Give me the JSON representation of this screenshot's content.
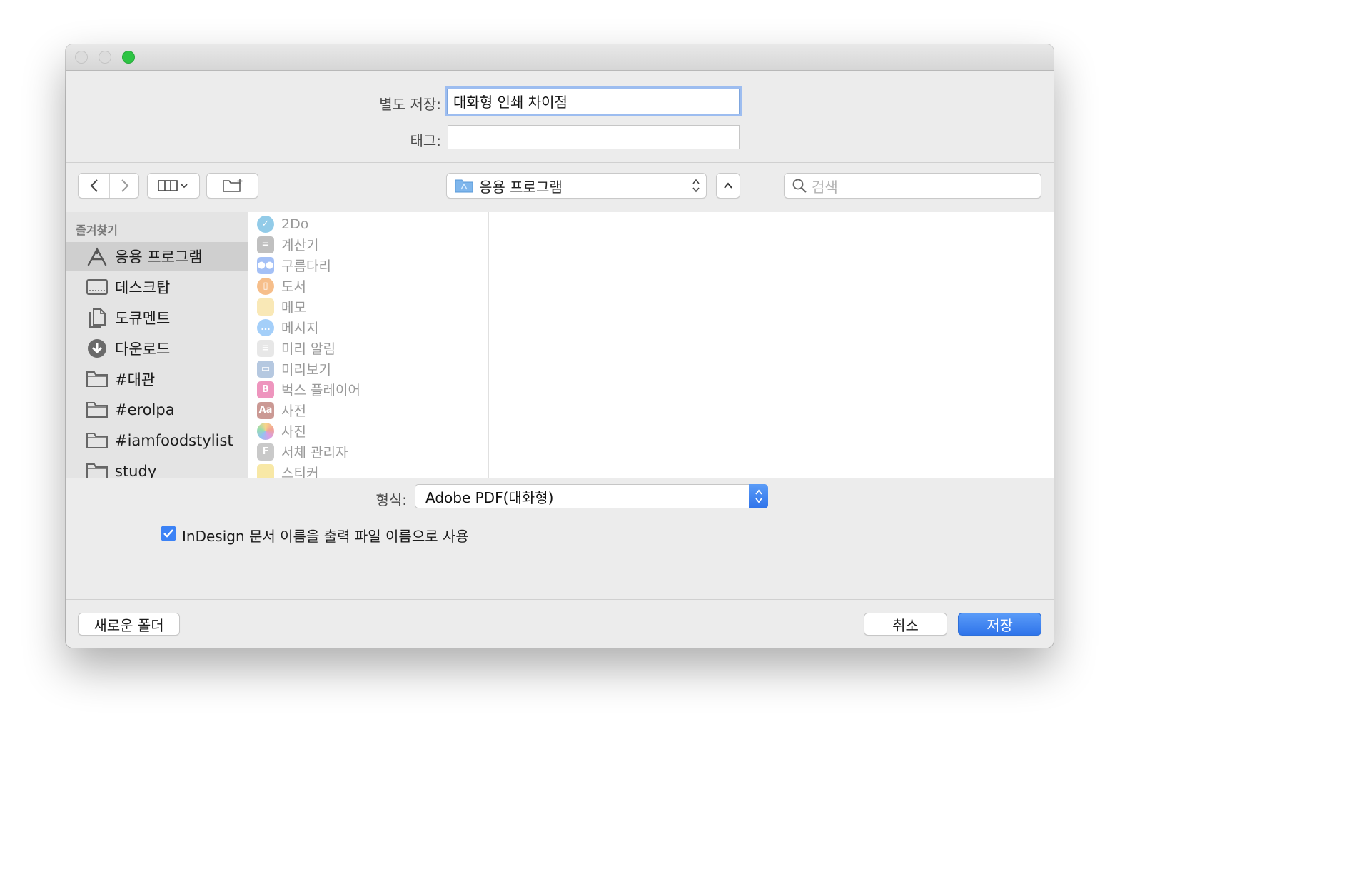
{
  "save_dialog": {
    "save_as_label": "별도 저장:",
    "save_as_value": "대화형 인쇄 차이점",
    "tags_label": "태그:",
    "tags_value": ""
  },
  "toolbar": {
    "location": "응용 프로그램",
    "search_placeholder": "검색"
  },
  "sidebar": {
    "section_title": "즐겨찾기",
    "items": [
      {
        "label": "응용 프로그램",
        "icon": "applications-icon",
        "selected": true
      },
      {
        "label": "데스크탑",
        "icon": "desktop-icon"
      },
      {
        "label": "도큐멘트",
        "icon": "documents-icon"
      },
      {
        "label": "다운로드",
        "icon": "downloads-icon"
      },
      {
        "label": "#대관",
        "icon": "folder-icon"
      },
      {
        "label": "#erolpa",
        "icon": "folder-icon"
      },
      {
        "label": "#iamfoodstylist",
        "icon": "folder-icon"
      },
      {
        "label": "study",
        "icon": "folder-icon"
      }
    ]
  },
  "file_list": {
    "items": [
      {
        "name": "2Do",
        "icon": "2do-app-icon"
      },
      {
        "name": "계산기",
        "icon": "calculator-app-icon"
      },
      {
        "name": "구름다리",
        "icon": "cloud-bridge-app-icon"
      },
      {
        "name": "도서",
        "icon": "books-app-icon"
      },
      {
        "name": "메모",
        "icon": "notes-app-icon"
      },
      {
        "name": "메시지",
        "icon": "messages-app-icon"
      },
      {
        "name": "미리 알림",
        "icon": "reminders-app-icon"
      },
      {
        "name": "미리보기",
        "icon": "preview-app-icon"
      },
      {
        "name": "벅스 플레이어",
        "icon": "bugs-player-app-icon"
      },
      {
        "name": "사전",
        "icon": "dictionary-app-icon"
      },
      {
        "name": "사진",
        "icon": "photos-app-icon"
      },
      {
        "name": "서체 관리자",
        "icon": "font-book-app-icon"
      },
      {
        "name": "스티커",
        "icon": "stickies-app-icon"
      }
    ]
  },
  "format": {
    "label": "형식:",
    "value": "Adobe PDF(대화형)"
  },
  "options": {
    "use_doc_name_label": "InDesign 문서 이름을 출력 파일 이름으로 사용",
    "use_doc_name_checked": true
  },
  "buttons": {
    "new_folder": "새로운 폴더",
    "cancel": "취소",
    "save": "저장"
  },
  "colors": {
    "accent": "#3b82f6",
    "zoom_light": "#2ec444"
  }
}
